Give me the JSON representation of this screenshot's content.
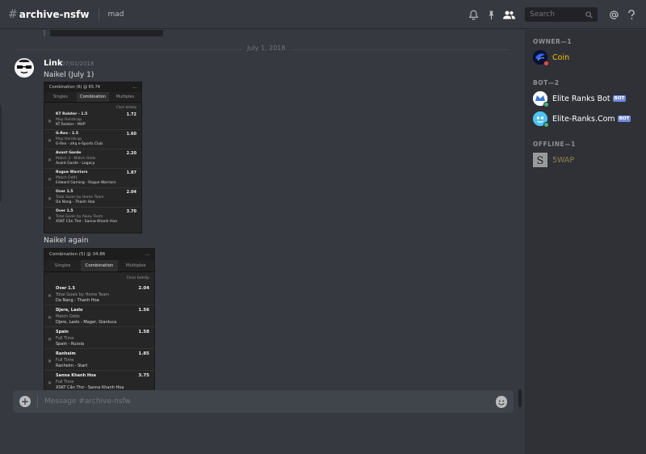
{
  "header": {
    "channel_name": "archive-nsfw",
    "topic": "mad",
    "search_placeholder": "Search"
  },
  "chat": {
    "date_divider": "July 1, 2018",
    "message": {
      "author": "Link",
      "timestamp": "07/01/2018",
      "text1": "Naikel (July 1)",
      "text2": "Naikel again"
    },
    "composer_placeholder": "Message #archive-nsfw"
  },
  "slip1": {
    "header": "Combination (6) @ 65.74",
    "menu": "...",
    "tabs": [
      "Singles",
      "Combination",
      "Multiples"
    ],
    "clear": "Clear betslip",
    "bets": [
      {
        "title": "KT Rolster - 1.5",
        "odds": "1.72",
        "market": "Map Handicap",
        "match": "KT Rolster - MVP"
      },
      {
        "title": "G-Rex - 1.5",
        "odds": "1.60",
        "market": "Map Handicap",
        "match": "G-Rex - ahq e-Sports Club"
      },
      {
        "title": "Avant Garde",
        "odds": "2.20",
        "market": "Match 3 - Match Odds",
        "match": "Avant Garde - Legacy"
      },
      {
        "title": "Rogue Warriors",
        "odds": "1.87",
        "market": "Match Odds",
        "match": "Edward Gaming - Rogue Warriors"
      },
      {
        "title": "Over 1.5",
        "odds": "2.04",
        "market": "Total Goals by Home Team",
        "match": "Da Nang - Thanh Hoa"
      },
      {
        "title": "Over 1.5",
        "odds": "3.70",
        "market": "Total Goals by Away Team",
        "match": "XSKT Cần Thơ - Sanna Khanh Hoa"
      }
    ]
  },
  "slip2": {
    "header": "Combination (5) @ 34.86",
    "menu": "...",
    "tabs": [
      "Singles",
      "Combination",
      "Multiples"
    ],
    "clear": "Clear betslip",
    "bets": [
      {
        "title": "Over 1.5",
        "odds": "2.04",
        "market": "Total Goals by Home Team",
        "match": "Da Nang - Thanh Hoa"
      },
      {
        "title": "Djere, Laslo",
        "odds": "1.56",
        "market": "Match Odds",
        "match": "Djere, Laslo - Mager, Gianluca"
      },
      {
        "title": "Spain",
        "odds": "1.58",
        "market": "Full Time",
        "match": "Spain - Russia"
      },
      {
        "title": "Ranheim",
        "odds": "1.85",
        "market": "Full Time",
        "match": "Ranheim - Start"
      },
      {
        "title": "Sanna Khanh Hoa",
        "odds": "3.75",
        "market": "Full Time",
        "match": "XSKT Cần Thơ - Sanna Khanh Hoa"
      }
    ]
  },
  "members": {
    "groups": [
      {
        "heading": "OWNER—1",
        "items": [
          {
            "name": "Coin",
            "bot": ""
          }
        ]
      },
      {
        "heading": "BOT—2",
        "items": [
          {
            "name": "Elite Ranks Bot",
            "bot": "BOT"
          },
          {
            "name": "Elite-Ranks.Com",
            "bot": "BOT"
          }
        ]
      },
      {
        "heading": "OFFLINE—1",
        "items": [
          {
            "name": "5WAP",
            "bot": ""
          }
        ]
      }
    ]
  },
  "colors": {
    "owner_name": "#f1c40f",
    "offline_name": "#c9b458",
    "bot_tag": "#7289da",
    "dnd_status": "#f04747",
    "online_status": "#43b581"
  }
}
